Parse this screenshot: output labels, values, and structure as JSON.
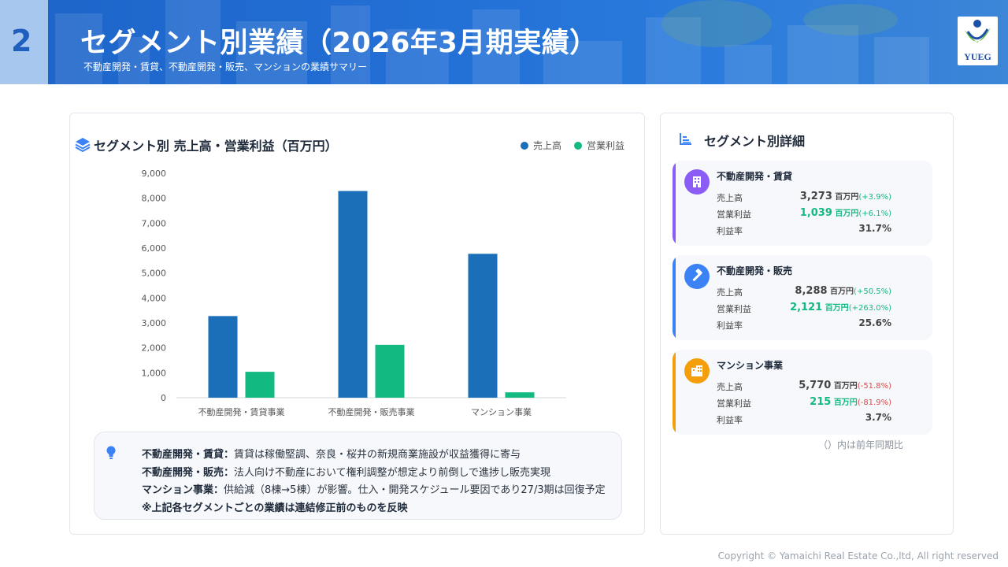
{
  "header": {
    "page_number": "2",
    "title": "セグメント別業績（2026年3月期実績）",
    "subtitle": "不動産開発・賃貸、不動産開発・販売、マンションの業績サマリー",
    "logo_text": "YUEG"
  },
  "chart_panel": {
    "title": "セグメント別 売上高・営業利益（百万円）",
    "legend": [
      "売上高",
      "営業利益"
    ]
  },
  "chart_data": {
    "type": "bar",
    "title": "セグメント別 売上高・営業利益（百万円）",
    "categories": [
      "不動産開発・賃貸事業",
      "不動産開発・販売事業",
      "マンション事業"
    ],
    "series": [
      {
        "name": "売上高",
        "values": [
          3273,
          8288,
          5770
        ],
        "color": "#1a6fb8"
      },
      {
        "name": "営業利益",
        "values": [
          1039,
          2121,
          215
        ],
        "color": "#12b981"
      }
    ],
    "ylim": [
      0,
      9000
    ],
    "yticks": [
      "0",
      "1,000",
      "2,000",
      "3,000",
      "4,000",
      "5,000",
      "6,000",
      "7,000",
      "8,000",
      "9,000"
    ],
    "legend_position": "top-right",
    "grid": false
  },
  "notes": [
    {
      "label": "不動産開発・賃貸：",
      "text": "賃貸は稼働堅調、奈良・桜井の新規商業施設が収益獲得に寄与"
    },
    {
      "label": "不動産開発・販売：",
      "text": "法人向け不動産において権利調整が想定より前倒しで進捗し販売実現"
    },
    {
      "label": "マンション事業：",
      "text": "供給減（8棟→5棟）が影響。仕入・開発スケジュール要因であり27/3期は回復予定"
    },
    {
      "label": "※上記各セグメントごとの業績は連結修正前のものを反映",
      "text": ""
    }
  ],
  "details": {
    "title": "セグメント別詳細",
    "unit": "百万円",
    "labels": {
      "sales": "売上高",
      "profit": "営業利益",
      "margin": "利益率"
    },
    "segments": [
      {
        "name": "不動産開発・賃貸",
        "sales": "3,273",
        "sales_change": "(+3.9%)",
        "profit": "1,039",
        "profit_change": "(+6.1%)",
        "margin": "31.7%",
        "accent": "#8b5cf6",
        "icon": "building-icon"
      },
      {
        "name": "不動産開発・販売",
        "sales": "8,288",
        "sales_change": "(+50.5%)",
        "profit": "2,121",
        "profit_change": "(+263.0%)",
        "margin": "25.6%",
        "accent": "#3b82f6",
        "icon": "hammer-icon"
      },
      {
        "name": "マンション事業",
        "sales": "5,770",
        "sales_change": "(-51.8%)",
        "profit": "215",
        "profit_change": "(-81.9%)",
        "margin": "3.7%",
        "accent": "#f59e0b",
        "icon": "city-icon"
      }
    ],
    "footnote": "（）内は前年同期比"
  },
  "colors": {
    "positive": "#12b981",
    "negative": "#e04848",
    "header": "#2370d6"
  },
  "copyright": "Copyright © Yamaichi Real Estate Co.,ltd, All right reserved"
}
